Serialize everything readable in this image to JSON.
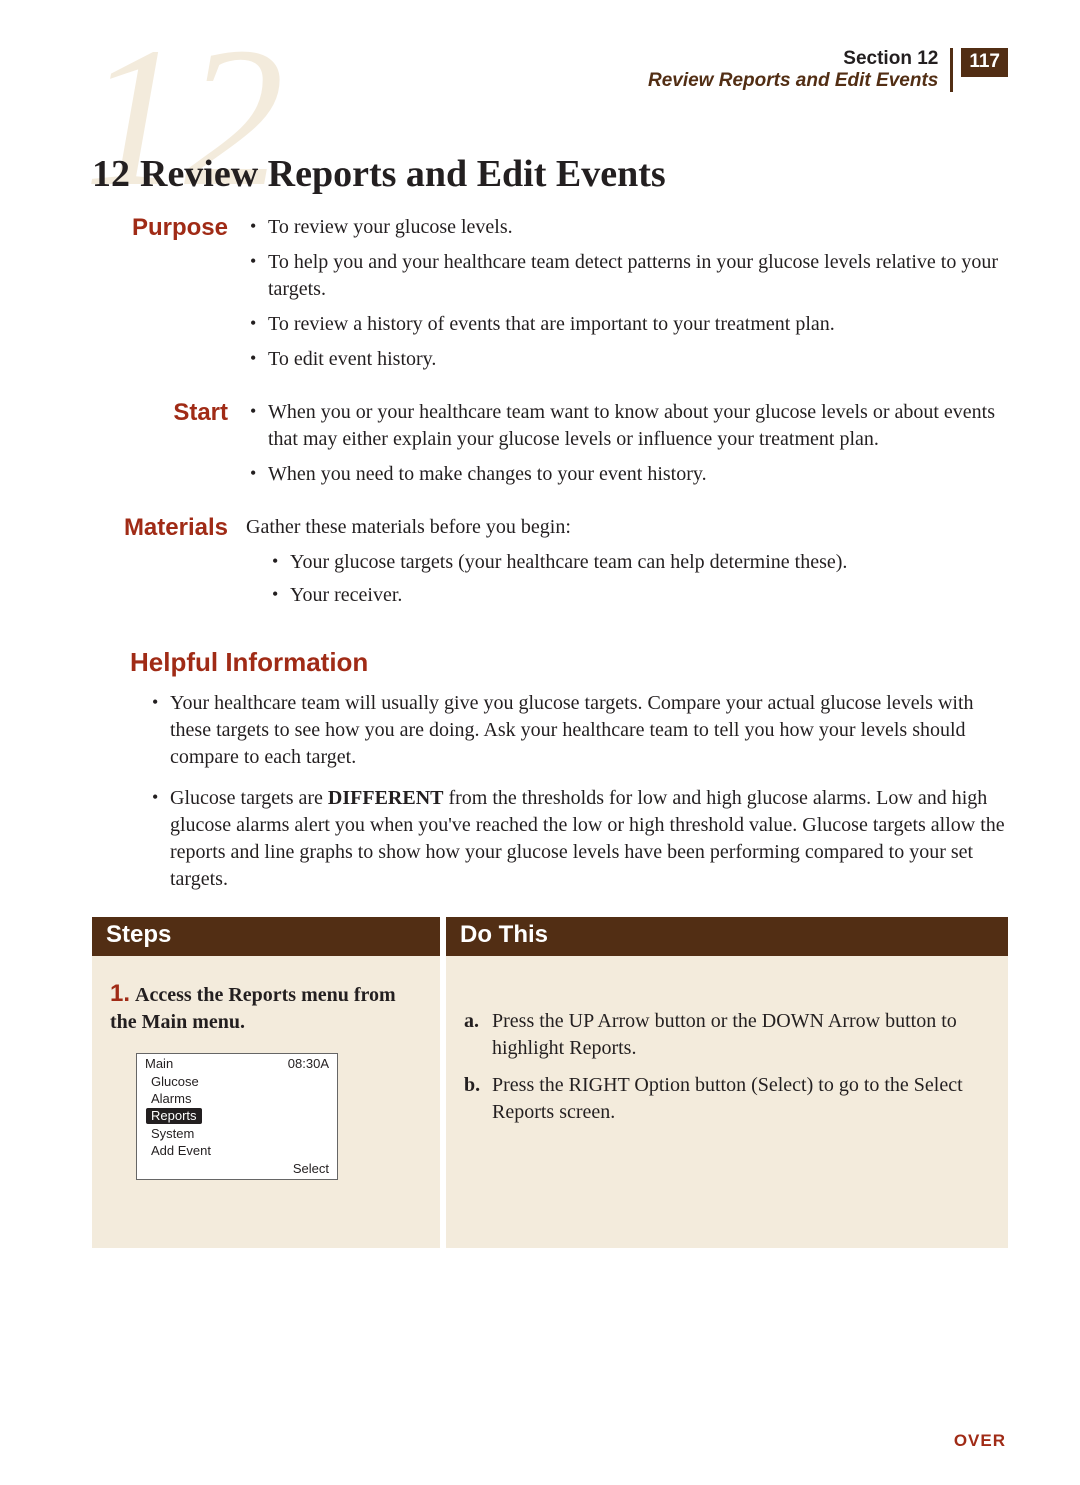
{
  "header": {
    "section_label": "Section 12",
    "page_number": "117",
    "subtitle": "Review Reports and Edit Events"
  },
  "watermark_number": "12",
  "chapter": {
    "number": "12",
    "title": "Review Reports and Edit Events"
  },
  "purpose": {
    "label": "Purpose",
    "items": [
      "To review your glucose levels.",
      "To help you and your healthcare team detect patterns in your glucose levels relative to your targets.",
      "To review a history of events that are important to your treatment plan.",
      "To edit event history."
    ]
  },
  "start": {
    "label": "Start",
    "items": [
      "When you or your healthcare team want to know about your glucose levels or about events that may either explain your glucose levels or influence your treatment plan.",
      "When you need to make changes to your event history."
    ]
  },
  "materials": {
    "label": "Materials",
    "intro": "Gather these materials before you begin:",
    "items": [
      "Your glucose targets (your healthcare team can help determine these).",
      "Your receiver."
    ]
  },
  "helpful": {
    "heading": "Helpful Information",
    "items": [
      {
        "pre": "Your healthcare team will usually give you glucose targets. Compare your actual glucose levels with these targets to see how you are doing. Ask your healthcare team to tell you how your levels should compare to each target."
      },
      {
        "pre": "Glucose targets are ",
        "bold": "DIFFERENT",
        "post": " from the thresholds for low and high glucose alarms. Low and high glucose alarms alert you when you've reached the low or high threshold value. Glucose targets allow the reports and line graphs to show how your glucose levels have been performing compared to your set targets."
      }
    ]
  },
  "steps": {
    "col_head_left": "Steps",
    "col_head_right": "Do This",
    "step1": {
      "number": "1.",
      "title": "Access the Reports menu from the Main menu."
    },
    "device": {
      "title": "Main",
      "time": "08:30A",
      "items": [
        "Glucose",
        "Alarms",
        "Reports",
        "System",
        "Add Event"
      ],
      "selected_index": 2,
      "softkey_right": "Select"
    },
    "dothis": [
      {
        "marker": "a.",
        "text": "Press the UP Arrow button or the DOWN Arrow button to highlight Reports."
      },
      {
        "marker": "b.",
        "text": "Press the RIGHT Option button (Select) to go to the Select Reports screen."
      }
    ]
  },
  "footer_over": "OVER"
}
